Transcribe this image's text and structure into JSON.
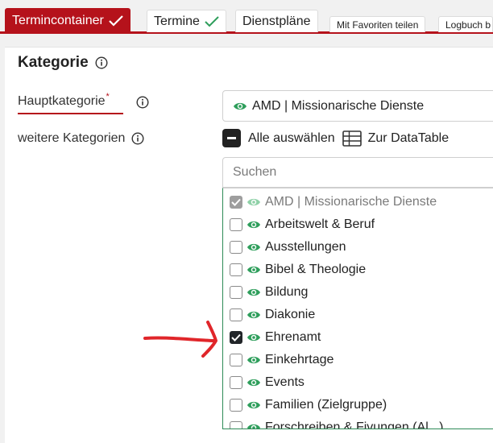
{
  "tabs": [
    {
      "label": "Termincontainer",
      "active": true,
      "checked": true
    },
    {
      "label": "Termine",
      "active": false,
      "checked": true
    },
    {
      "label": "Dienstpläne",
      "active": false,
      "checked": false
    },
    {
      "label": "Mit Favoriten teilen",
      "active": false,
      "checked": false
    },
    {
      "label": "Logbuch b",
      "active": false,
      "checked": false
    }
  ],
  "section": {
    "title": "Kategorie",
    "main_label": "Hauptkategorie",
    "required_mark": "*",
    "main_value": "AMD | Missionarische Dienste",
    "more_label": "weitere Kategorien",
    "select_all_label": "Alle auswählen",
    "datatable_label": "Zur DataTable",
    "search_placeholder": "Suchen"
  },
  "categories": [
    {
      "label": "AMD | Missionarische Dienste",
      "checked": true,
      "disabled": true
    },
    {
      "label": "Arbeitswelt & Beruf",
      "checked": false,
      "disabled": false
    },
    {
      "label": "Ausstellungen",
      "checked": false,
      "disabled": false
    },
    {
      "label": "Bibel & Theologie",
      "checked": false,
      "disabled": false
    },
    {
      "label": "Bildung",
      "checked": false,
      "disabled": false
    },
    {
      "label": "Diakonie",
      "checked": false,
      "disabled": false
    },
    {
      "label": "Ehrenamt",
      "checked": true,
      "disabled": false
    },
    {
      "label": "Einkehrtage",
      "checked": false,
      "disabled": false
    },
    {
      "label": "Events",
      "checked": false,
      "disabled": false
    },
    {
      "label": "Familien (Zielgruppe)",
      "checked": false,
      "disabled": false
    },
    {
      "label": "Forschreiben & Fivungen (Al...)",
      "checked": false,
      "disabled": false
    }
  ],
  "colors": {
    "brand": "#b5121b",
    "eye": "#2e9e5b",
    "eye_disabled": "#8fd1a8",
    "check": "#212529",
    "annotation": "#e0262a"
  },
  "icons": {
    "info": "info-icon",
    "eye": "eye-icon",
    "table": "table-icon",
    "check": "check-icon"
  }
}
